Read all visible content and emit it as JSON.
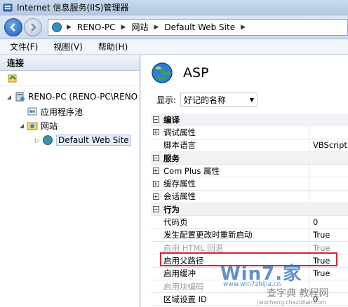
{
  "window": {
    "title": "Internet 信息服务(IIS)管理器"
  },
  "address": {
    "crumbs": [
      "RENO-PC",
      "网站",
      "Default Web Site"
    ]
  },
  "menu": {
    "items": [
      "文件(F)",
      "视图(V)",
      "帮助(H)"
    ]
  },
  "connections": {
    "header": "连接",
    "tree": {
      "root": "RENO-PC (RENO-PC\\RENO",
      "app_pools": "应用程序池",
      "sites": "网站",
      "default_site": "Default Web Site"
    }
  },
  "feature": {
    "title": "ASP",
    "display_label": "显示:",
    "display_value": "好记的名称"
  },
  "grid": {
    "rows": [
      {
        "type": "cat",
        "exp": "⊟",
        "name": "编译",
        "value": ""
      },
      {
        "type": "group",
        "exp": "+",
        "name": "调试属性",
        "value": ""
      },
      {
        "type": "prop",
        "exp": "",
        "name": "脚本语言",
        "value": "VBScript"
      },
      {
        "type": "cat",
        "exp": "⊟",
        "name": "服务",
        "value": ""
      },
      {
        "type": "group",
        "exp": "+",
        "name": "Com Plus 属性",
        "value": ""
      },
      {
        "type": "group",
        "exp": "+",
        "name": "缓存属性",
        "value": ""
      },
      {
        "type": "group",
        "exp": "+",
        "name": "会话属性",
        "value": ""
      },
      {
        "type": "cat",
        "exp": "⊟",
        "name": "行为",
        "value": ""
      },
      {
        "type": "prop",
        "exp": "",
        "name": "代码页",
        "value": "0"
      },
      {
        "type": "prop",
        "exp": "",
        "name": "发生配置更改时重新启动",
        "value": "True"
      },
      {
        "type": "disabled",
        "exp": "",
        "name": "启用 HTML 回退",
        "value": "True"
      },
      {
        "type": "prop",
        "exp": "",
        "name": "启用父路径",
        "value": "True"
      },
      {
        "type": "prop",
        "exp": "",
        "name": "启用缓冲",
        "value": "True"
      },
      {
        "type": "disabled",
        "exp": "",
        "name": "启用块编码",
        "value": ""
      },
      {
        "type": "prop",
        "exp": "",
        "name": "区域设置 ID",
        "value": "0"
      }
    ]
  },
  "watermark": {
    "logo": "Win7.家",
    "url": "www.win7zhijia.cn",
    "site_cn": "查字典 教程网",
    "site_url": "jiaocheng.chazidian.com"
  },
  "colors": {
    "accent": "#1f5db5",
    "highlight": "#d7262c"
  }
}
